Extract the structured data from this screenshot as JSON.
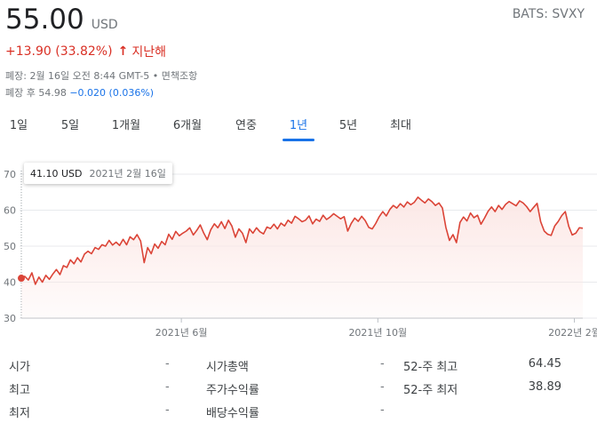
{
  "quote": {
    "price": "55.00",
    "currency": "USD",
    "ticker": "BATS: SVXY",
    "change": "+13.90 (33.82%)",
    "change_arrow": "↑",
    "period": "지난해",
    "close_info": "폐장: 2월 16일 오전 8:44 GMT-5 • 면책조항",
    "after_label": "폐장 후 54.98",
    "after_change": "−0.020 (0.036%)"
  },
  "tabs": [
    {
      "label": "1일",
      "active": false
    },
    {
      "label": "5일",
      "active": false
    },
    {
      "label": "1개월",
      "active": false
    },
    {
      "label": "6개월",
      "active": false
    },
    {
      "label": "연중",
      "active": false
    },
    {
      "label": "1년",
      "active": true
    },
    {
      "label": "5년",
      "active": false
    },
    {
      "label": "최대",
      "active": false
    }
  ],
  "tooltip": {
    "value": "41.10 USD",
    "date": "2021년 2월 16일"
  },
  "chart_data": {
    "type": "area",
    "ylim": [
      30,
      70
    ],
    "yticks": [
      70,
      60,
      50,
      40,
      30
    ],
    "xticks": [
      {
        "label": "2021년 6월",
        "t": 0.285
      },
      {
        "label": "2021년 10월",
        "t": 0.635
      },
      {
        "label": "2022년 2월",
        "t": 0.985
      }
    ],
    "line_color": "#db4437",
    "baseline": 41.1,
    "values": [
      41.1,
      41.6,
      40.6,
      42.6,
      39.4,
      41.4,
      40.0,
      41.9,
      40.8,
      42.3,
      43.5,
      42.1,
      44.6,
      44.1,
      46.2,
      45.1,
      46.8,
      45.6,
      47.8,
      48.6,
      47.9,
      49.6,
      49.1,
      50.4,
      50.0,
      51.6,
      50.3,
      51.1,
      50.2,
      51.9,
      50.4,
      52.6,
      51.8,
      53.2,
      51.4,
      45.4,
      49.6,
      47.9,
      50.6,
      49.4,
      51.3,
      50.4,
      53.3,
      51.9,
      54.1,
      52.9,
      53.6,
      54.2,
      55.1,
      53.1,
      54.4,
      55.9,
      53.6,
      51.8,
      54.6,
      56.2,
      55.1,
      56.8,
      54.9,
      57.2,
      55.6,
      52.5,
      54.8,
      53.6,
      51.0,
      54.8,
      53.6,
      55.1,
      54.0,
      53.4,
      55.3,
      54.9,
      56.1,
      54.8,
      56.4,
      55.6,
      57.2,
      56.4,
      58.3,
      57.6,
      56.8,
      57.2,
      58.4,
      56.2,
      57.5,
      56.9,
      58.6,
      57.4,
      58.1,
      59.0,
      58.3,
      57.6,
      58.2,
      54.2,
      56.3,
      57.8,
      56.9,
      58.3,
      57.1,
      55.2,
      54.8,
      56.3,
      58.2,
      59.6,
      58.4,
      60.2,
      61.3,
      60.6,
      61.8,
      60.9,
      62.3,
      61.5,
      62.2,
      63.6,
      62.8,
      62.0,
      63.1,
      62.4,
      61.3,
      62.0,
      60.6,
      55.2,
      51.6,
      53.2,
      51.0,
      56.6,
      58.1,
      57.0,
      59.2,
      57.9,
      58.6,
      56.1,
      57.8,
      59.7,
      60.9,
      59.6,
      61.3,
      60.2,
      61.6,
      62.4,
      61.8,
      61.2,
      62.6,
      62.0,
      61.0,
      59.6,
      60.8,
      61.9,
      56.8,
      54.2,
      53.3,
      53.0,
      55.6,
      56.9,
      58.5,
      59.6,
      55.5,
      53.1,
      53.6,
      55.1,
      55.0
    ]
  },
  "stats": [
    {
      "c1_label": "시가",
      "c1_value": "-",
      "c2_label": "시가총액",
      "c2_value": "-",
      "c3_label": "52-주 최고",
      "c3_value": "64.45"
    },
    {
      "c1_label": "최고",
      "c1_value": "-",
      "c2_label": "주가수익률",
      "c2_value": "-",
      "c3_label": "52-주 최저",
      "c3_value": "38.89"
    },
    {
      "c1_label": "최저",
      "c1_value": "-",
      "c2_label": "배당수익률",
      "c2_value": "-",
      "c3_label": "",
      "c3_value": ""
    }
  ]
}
